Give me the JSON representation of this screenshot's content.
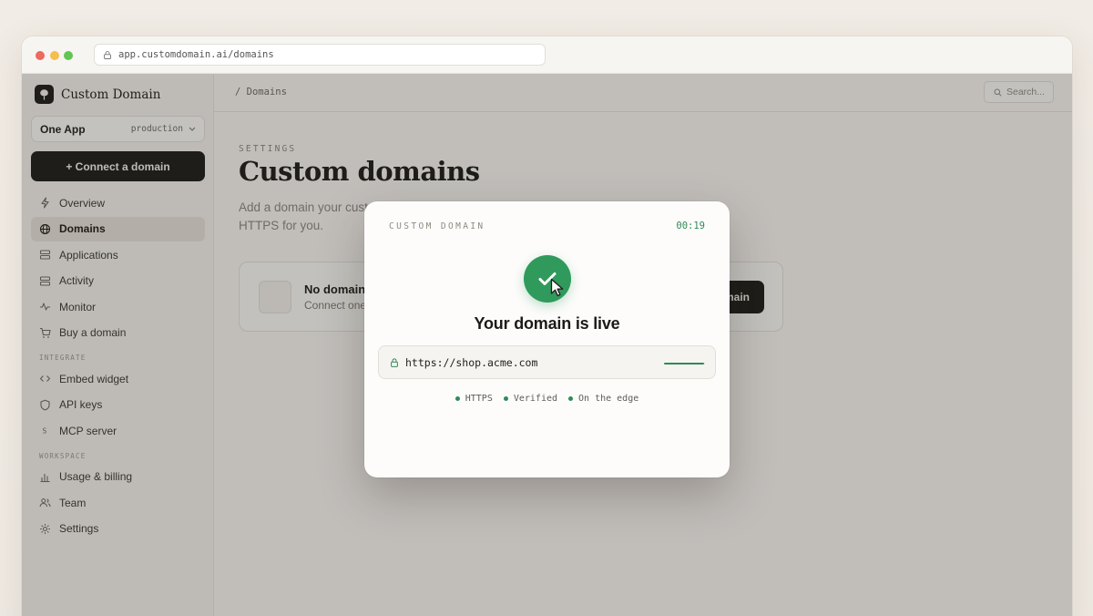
{
  "browser": {
    "url": "app.customdomain.ai/domains"
  },
  "sidebar": {
    "brand": "Custom Domain",
    "env": {
      "app": "One App",
      "name": "production"
    },
    "connect_label": "+ Connect a domain",
    "items": [
      {
        "label": "Overview",
        "icon": "bolt-icon"
      },
      {
        "label": "Domains",
        "icon": "globe-icon",
        "active": true
      },
      {
        "label": "Applications",
        "icon": "stack-icon"
      },
      {
        "label": "Activity",
        "icon": "stack-icon"
      },
      {
        "label": "Monitor",
        "icon": "pulse-icon"
      },
      {
        "label": "Buy a domain",
        "icon": "cart-icon"
      }
    ],
    "integrate_label": "INTEGRATE",
    "integrate_items": [
      {
        "label": "Embed widget",
        "icon": "code-icon"
      },
      {
        "label": "API keys",
        "icon": "shield-icon"
      },
      {
        "label": "MCP server",
        "icon": "dollar-icon"
      }
    ],
    "workspace_label": "WORKSPACE",
    "workspace_items": [
      {
        "label": "Usage & billing",
        "icon": "bar-chart-icon"
      },
      {
        "label": "Team",
        "icon": "users-icon"
      },
      {
        "label": "Settings",
        "icon": "gear-icon"
      }
    ]
  },
  "header": {
    "breadcrumb": "/  Domains",
    "search_placeholder": "Search..."
  },
  "main": {
    "section_label": "SETTINGS",
    "title": "Custom domains",
    "description": "Add a domain your customers will see. We handle DNS, verification, and HTTPS for you.",
    "empty": {
      "title": "No domains yet",
      "subtitle": "Connect one to get started.",
      "button": "Connect a domain"
    }
  },
  "modal": {
    "label": "CUSTOM DOMAIN",
    "timer": "00:19",
    "title": "Your domain is live",
    "url": "https://shop.acme.com",
    "progress": 0.97,
    "badges": [
      "HTTPS",
      "Verified",
      "On the edge"
    ],
    "accent": "#2f9a5c"
  }
}
